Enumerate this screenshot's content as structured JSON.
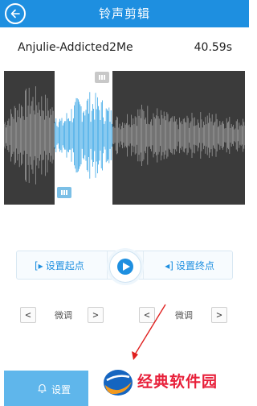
{
  "header": {
    "title": "铃声剪辑",
    "back_icon": "arrow-left-icon"
  },
  "song": {
    "name": "Anjulie-Addicted2Me",
    "duration": "40.59s"
  },
  "waveform": {
    "selection_start": 0.21,
    "selection_end": 0.45
  },
  "controls": {
    "set_start_label": "设置起点",
    "set_end_label": "设置终点",
    "play_icon": "play-icon"
  },
  "fine_tune": {
    "left": {
      "prev": "<",
      "label": "微调",
      "next": ">"
    },
    "right": {
      "prev": "<",
      "label": "微调",
      "next": ">"
    }
  },
  "bottom": {
    "set_label": "设置",
    "icon": "bell-icon"
  },
  "watermark": {
    "text": "经典软件园"
  },
  "colors": {
    "accent": "#1e8fe0",
    "selection": "#3aa6e6",
    "wave": "#9a9a9a",
    "bg_dark": "#3b3b3b"
  }
}
